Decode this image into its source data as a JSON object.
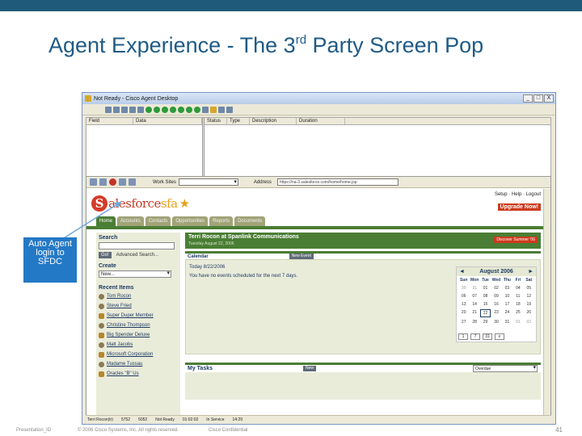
{
  "slide": {
    "title_pre": "Agent Experience - The 3",
    "title_sup": "rd",
    "title_post": " Party Screen Pop",
    "callout": "Auto Agent login to SFDC",
    "footer_id": "Presentation_ID",
    "footer_copyright": "© 2006 Cisco Systems, Inc. All rights reserved.",
    "footer_confidential": "Cisco Confidential",
    "page_number": "41",
    "colors": {
      "topbar": "#1f5a7a",
      "title": "#1f5b86",
      "callout": "#2479c6"
    }
  },
  "window": {
    "title": "Not Ready - Cisco Agent Desktop",
    "minimize": "_",
    "maximize": "□",
    "close": "X"
  },
  "ctd_grid": {
    "left_columns": [
      "Field",
      "Data"
    ],
    "right_columns": [
      "Status",
      "Type",
      "Description",
      "Duration"
    ]
  },
  "browser": {
    "work_sites_label": "Work Sites",
    "address_label": "Address",
    "address_value": "https://na-3.salesforce.com/home/home.jsp"
  },
  "salesforce": {
    "logo_word": "alesforce",
    "logo_s": "S",
    "logo_sfa": "sfa",
    "top_links": "Setup · Help · Logout",
    "upgrade": "Upgrade Now!",
    "tabs": [
      "Home",
      "Accounts",
      "Contacts",
      "Opportunities",
      "Reports",
      "Documents"
    ],
    "search_heading": "Search",
    "go_label": "Go!",
    "advanced_search": "Advanced Search...",
    "create_heading": "Create",
    "create_value": "New...",
    "recent_heading": "Recent Items",
    "recent_items": [
      "Tom Rocon",
      "Steve Fried",
      "Super Duper Member",
      "Christine Thompson",
      "Big Spender Deluxe",
      "Matt Jacobs",
      "Microsoft Corporation",
      "Madame Tussau",
      "Oracles \"B\" Us"
    ],
    "banner_name": "Terri Rocon at Spanlink Communications",
    "banner_date": "Tuesday August 22, 2006",
    "discover": "Discover Summer '06",
    "calendar_heading": "Calendar",
    "new_event": "New Event",
    "today": "Today 8/22/2006",
    "cal_message": "You have no events scheduled for the next 7 days.",
    "tasks_heading": "My Tasks",
    "new_task": "New",
    "task_filter": "Overdue"
  },
  "minicalendar": {
    "month": "August 2006",
    "prev": "◄",
    "next": "►",
    "day_names": [
      "Sun",
      "Mon",
      "Tue",
      "Wed",
      "Thu",
      "Fri",
      "Sat"
    ],
    "weeks": [
      [
        "30",
        "31",
        "01",
        "02",
        "03",
        "04",
        "05"
      ],
      [
        "06",
        "07",
        "08",
        "09",
        "10",
        "11",
        "12"
      ],
      [
        "13",
        "14",
        "15",
        "16",
        "17",
        "18",
        "19"
      ],
      [
        "20",
        "21",
        "22",
        "23",
        "24",
        "25",
        "26"
      ],
      [
        "27",
        "28",
        "29",
        "30",
        "31",
        "01",
        "02"
      ]
    ]
  },
  "statusbar": {
    "agent": "Terri Rocon(tr)",
    "extension": "5752",
    "phone": "5052",
    "state": "Not Ready",
    "state_time": "01:02:02",
    "service": "In Service",
    "clock": "14:29"
  }
}
